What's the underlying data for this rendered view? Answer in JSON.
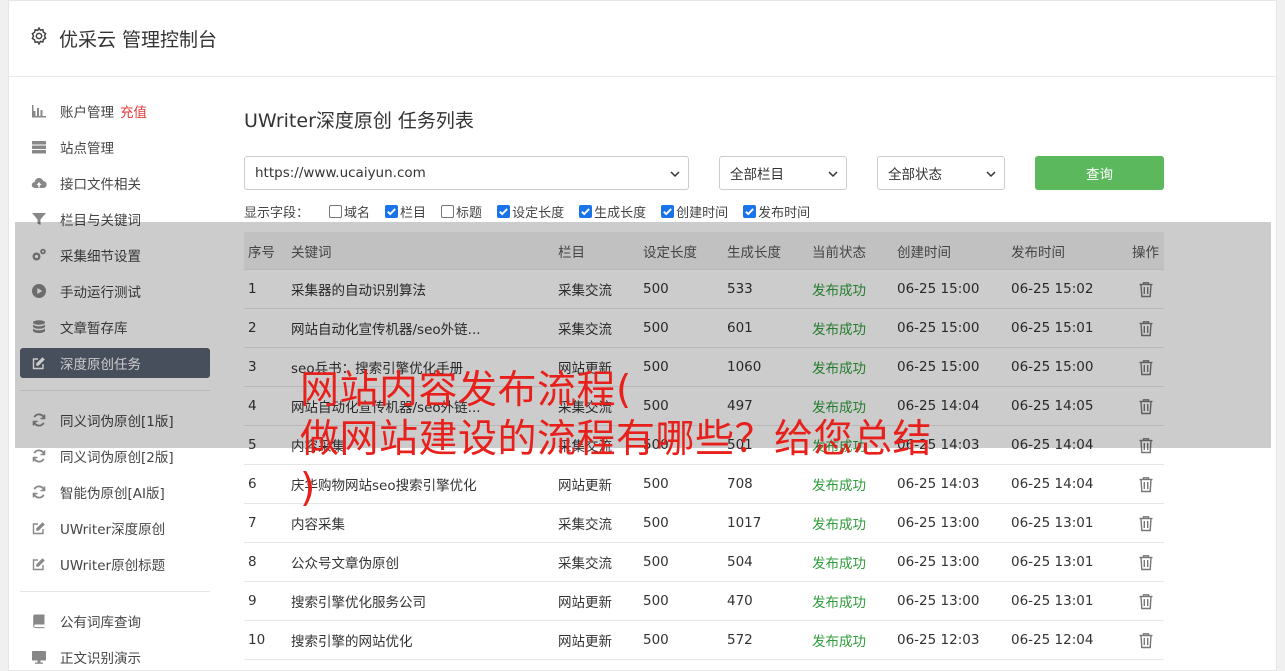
{
  "app": {
    "title": "优采云 管理控制台",
    "icon": "gear-icon"
  },
  "sidebar": {
    "groups": [
      [
        {
          "label": "账户管理",
          "extra": "充值",
          "icon": "bar-chart-icon"
        },
        {
          "label": "站点管理",
          "icon": "server-icon"
        },
        {
          "label": "接口文件相关",
          "icon": "cloud-upload-icon"
        },
        {
          "label": "栏目与关键词",
          "icon": "filter-icon"
        },
        {
          "label": "采集细节设置",
          "icon": "gears-icon"
        },
        {
          "label": "手动运行测试",
          "icon": "play-circle-icon"
        },
        {
          "label": "文章暂存库",
          "icon": "database-icon"
        },
        {
          "label": "深度原创任务",
          "icon": "edit-icon",
          "active": true
        }
      ],
      [
        {
          "label": "同义词伪原创[1版]",
          "icon": "refresh-icon"
        },
        {
          "label": "同义词伪原创[2版]",
          "icon": "refresh-icon"
        },
        {
          "label": "智能伪原创[AI版]",
          "icon": "refresh-icon"
        },
        {
          "label": "UWriter深度原创",
          "icon": "edit-icon"
        },
        {
          "label": "UWriter原创标题",
          "icon": "edit-icon"
        }
      ],
      [
        {
          "label": "公有词库查询",
          "icon": "book-icon"
        },
        {
          "label": "正文识别演示",
          "icon": "monitor-icon"
        }
      ]
    ]
  },
  "main": {
    "title": "UWriter深度原创 任务列表",
    "filters": {
      "site": "https://www.ucaiyun.com",
      "category": "全部栏目",
      "status": "全部状态",
      "query_label": "查询"
    },
    "fields_label": "显示字段：",
    "fields": [
      {
        "label": "域名",
        "checked": false
      },
      {
        "label": "栏目",
        "checked": true
      },
      {
        "label": "标题",
        "checked": false
      },
      {
        "label": "设定长度",
        "checked": true
      },
      {
        "label": "生成长度",
        "checked": true
      },
      {
        "label": "创建时间",
        "checked": true
      },
      {
        "label": "发布时间",
        "checked": true
      }
    ],
    "table": {
      "columns": [
        "序号",
        "关键词",
        "栏目",
        "设定长度",
        "生成长度",
        "当前状态",
        "创建时间",
        "发布时间",
        "操作"
      ],
      "rows": [
        [
          "1",
          "采集器的自动识别算法",
          "采集交流",
          "500",
          "533",
          "发布成功",
          "06-25 15:00",
          "06-25 15:02"
        ],
        [
          "2",
          "网站自动化宣传机器/seo外链...",
          "采集交流",
          "500",
          "601",
          "发布成功",
          "06-25 15:00",
          "06-25 15:01"
        ],
        [
          "3",
          "seo兵书：搜索引擎优化手册",
          "网站更新",
          "500",
          "1060",
          "发布成功",
          "06-25 15:00",
          "06-25 15:00"
        ],
        [
          "4",
          "网站自动化宣传机器/seo外链...",
          "采集交流",
          "500",
          "497",
          "发布成功",
          "06-25 14:04",
          "06-25 14:05"
        ],
        [
          "5",
          "内容采集",
          "采集交流",
          "500",
          "501",
          "发布成功",
          "06-25 14:03",
          "06-25 14:04"
        ],
        [
          "6",
          "庆华购物网站seo搜索引擎优化",
          "网站更新",
          "500",
          "708",
          "发布成功",
          "06-25 14:03",
          "06-25 14:04"
        ],
        [
          "7",
          "内容采集",
          "采集交流",
          "500",
          "1017",
          "发布成功",
          "06-25 13:00",
          "06-25 13:01"
        ],
        [
          "8",
          "公众号文章伪原创",
          "采集交流",
          "500",
          "504",
          "发布成功",
          "06-25 13:00",
          "06-25 13:01"
        ],
        [
          "9",
          "搜索引擎优化服务公司",
          "网站更新",
          "500",
          "470",
          "发布成功",
          "06-25 13:00",
          "06-25 13:01"
        ],
        [
          "10",
          "搜索引擎的网站优化",
          "网站更新",
          "500",
          "572",
          "发布成功",
          "06-25 12:03",
          "06-25 12:04"
        ]
      ]
    }
  },
  "overlay": {
    "line1": "网站内容发布流程(",
    "line2": "做网站建设的流程有哪些？给您总结",
    "line3": ")"
  },
  "colors": {
    "accent_green": "#5cb85c",
    "active_nav": "#5b6373",
    "status_ok": "#2e9c3a",
    "overlay_text": "#e8201c",
    "recharge": "#e03c3c"
  }
}
